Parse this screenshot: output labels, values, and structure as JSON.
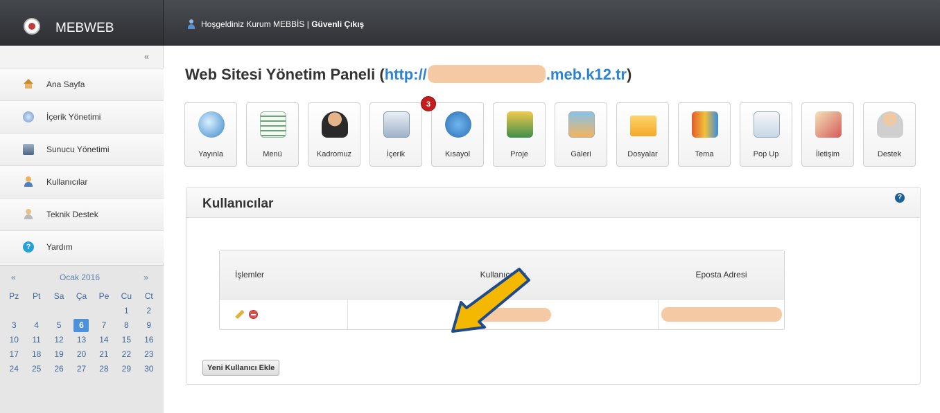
{
  "header": {
    "app_name": "MEBWEB",
    "welcome_text": "Hoşgeldiniz Kurum MEBBİS | ",
    "logout_label": "Güvenli Çıkış"
  },
  "sidebar": {
    "collapse_label": "«",
    "items": [
      {
        "label": "Ana Sayfa",
        "icon": "home-icon"
      },
      {
        "label": "İçerik Yönetimi",
        "icon": "content-icon"
      },
      {
        "label": "Sunucu Yönetimi",
        "icon": "server-icon"
      },
      {
        "label": "Kullanıcılar",
        "icon": "users-icon"
      },
      {
        "label": "Teknik Destek",
        "icon": "support-icon"
      },
      {
        "label": "Yardım",
        "icon": "help-icon"
      }
    ]
  },
  "calendar": {
    "prev_label": "«",
    "month_label": "Ocak 2016",
    "next_label": "»",
    "weekdays": [
      "Pz",
      "Pt",
      "Sa",
      "Ça",
      "Pe",
      "Cu",
      "Ct"
    ],
    "weeks": [
      [
        "",
        "",
        "",
        "",
        "",
        "1",
        "2"
      ],
      [
        "3",
        "4",
        "5",
        "6",
        "7",
        "8",
        "9"
      ],
      [
        "10",
        "11",
        "12",
        "13",
        "14",
        "15",
        "16"
      ],
      [
        "17",
        "18",
        "19",
        "20",
        "21",
        "22",
        "23"
      ],
      [
        "24",
        "25",
        "26",
        "27",
        "28",
        "29",
        "30"
      ]
    ],
    "selected_day": "6"
  },
  "main": {
    "title_prefix": "Web Sitesi Yönetim Paneli (",
    "url_start": "http://",
    "url_end": ".meb.k12.tr",
    "title_suffix": ")",
    "toolbar": [
      {
        "label": "Yayınla",
        "icon": "globe-icon"
      },
      {
        "label": "Menü",
        "icon": "menu-icon"
      },
      {
        "label": "Kadromuz",
        "icon": "staff-icon"
      },
      {
        "label": "İçerik",
        "icon": "content-icon",
        "badge": "3"
      },
      {
        "label": "Kısayol",
        "icon": "star-icon"
      },
      {
        "label": "Proje",
        "icon": "project-icon"
      },
      {
        "label": "Galeri",
        "icon": "gallery-icon"
      },
      {
        "label": "Dosyalar",
        "icon": "folder-icon"
      },
      {
        "label": "Tema",
        "icon": "theme-icon"
      },
      {
        "label": "Pop Up",
        "icon": "popup-icon"
      },
      {
        "label": "İletişim",
        "icon": "contact-icon"
      },
      {
        "label": "Destek",
        "icon": "support-icon"
      }
    ],
    "panel": {
      "title": "Kullanıcılar",
      "help_label": "?",
      "table": {
        "headers": [
          "İşlemler",
          "Kullanıcı Adı",
          "Eposta Adresi"
        ],
        "rows": [
          {
            "username": "",
            "email": ""
          }
        ]
      },
      "add_button": "Yeni Kullanıcı Ekle"
    }
  },
  "colors": {
    "accent": "#2c83d4",
    "badge": "#c41d1d",
    "arrow": "#f5b800",
    "redaction": "#f4c9a3"
  }
}
